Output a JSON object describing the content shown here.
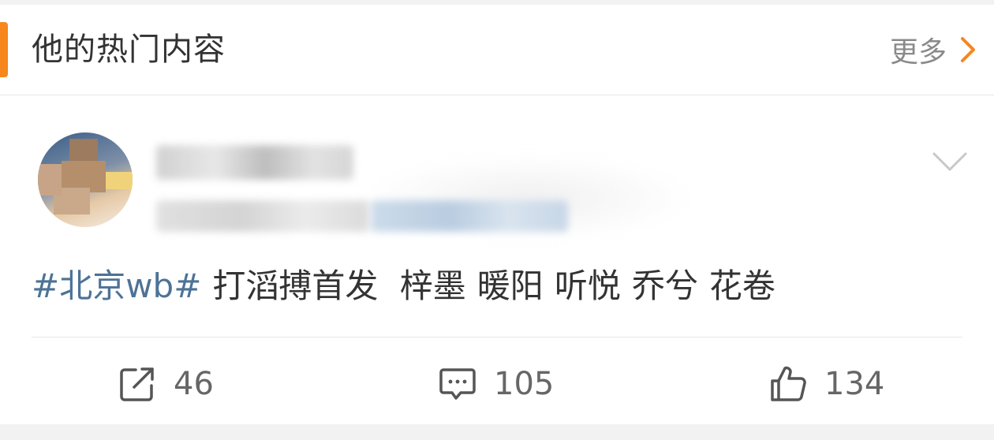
{
  "header": {
    "title": "他的热门内容",
    "more_label": "更多"
  },
  "post": {
    "hashtag": "#北京wb#",
    "words": [
      "打滔搏首发",
      "梓墨",
      "暖阳",
      "听悦",
      "乔兮",
      "花卷"
    ]
  },
  "actions": {
    "forward_count": "46",
    "comment_count": "105",
    "like_count": "134"
  },
  "icons": {
    "more": "chevron-right-icon",
    "dropdown": "chevron-down-icon",
    "forward": "share-icon",
    "comment": "comment-icon",
    "like": "thumbs-up-icon"
  },
  "colors": {
    "accent": "#f7861c",
    "hashtag": "#4d7396",
    "text": "#333333",
    "muted": "#8a8a8a"
  }
}
